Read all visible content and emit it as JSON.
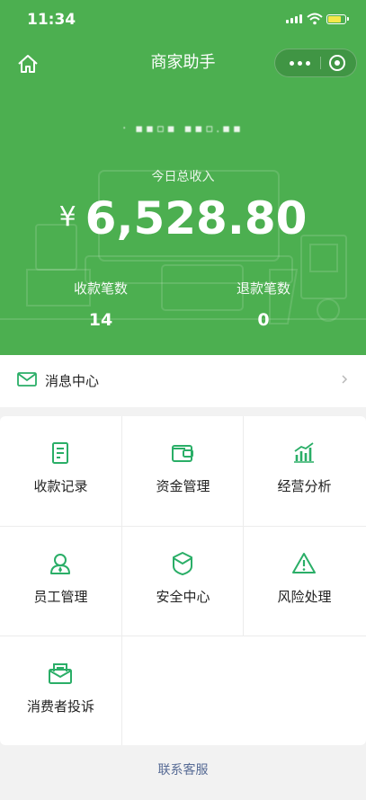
{
  "status_bar": {
    "time": "11:34"
  },
  "nav": {
    "title": "商家助手"
  },
  "merchant": {
    "name_masked": "·  ▪▪▫▪ ▪▪▫.▪▪"
  },
  "income": {
    "label": "今日总收入",
    "currency": "¥",
    "amount": "6,528.80"
  },
  "stats": [
    {
      "label": "收款笔数",
      "value": "14"
    },
    {
      "label": "退款笔数",
      "value": "0"
    }
  ],
  "message_center": {
    "label": "消息中心"
  },
  "menu": [
    {
      "label": "收款记录",
      "icon": "receipt-icon"
    },
    {
      "label": "资金管理",
      "icon": "wallet-icon"
    },
    {
      "label": "经营分析",
      "icon": "bar-chart-icon"
    },
    {
      "label": "员工管理",
      "icon": "user-icon"
    },
    {
      "label": "安全中心",
      "icon": "shield-icon"
    },
    {
      "label": "风险处理",
      "icon": "warning-icon"
    },
    {
      "label": "消费者投诉",
      "icon": "complaint-mail-icon"
    }
  ],
  "footer": {
    "contact_label": "联系客服"
  },
  "colors": {
    "primary": "#4caf50",
    "icon_green": "#2aae67",
    "link": "#576b95"
  }
}
